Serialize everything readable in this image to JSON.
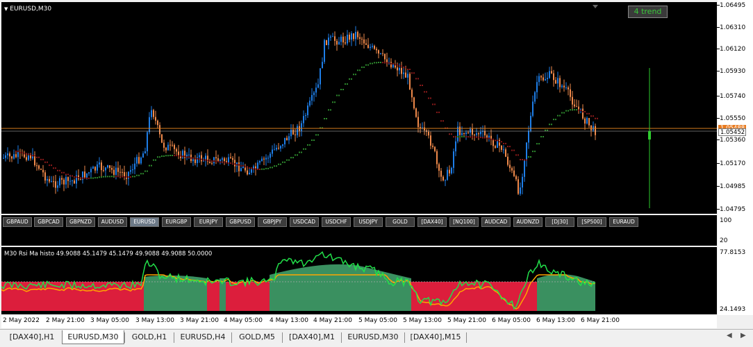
{
  "main_chart": {
    "title": "EURUSD,M30",
    "trend_button": "4 trend",
    "current_price_box": "1.05488",
    "current_price_box2": "1.05452",
    "price_axis": [
      "1.06495",
      "1.06310",
      "1.06120",
      "1.05930",
      "1.05740",
      "1.05550",
      "1.05360",
      "1.05170",
      "1.04985",
      "1.04795"
    ]
  },
  "symbol_panel": {
    "axis": [
      "100",
      "20"
    ],
    "buttons": [
      "GBPAUD",
      "GBPCAD",
      "GBPNZD",
      "AUDUSD",
      "EURUSD",
      "EURGBP",
      "EURJPY",
      "GBPUSD",
      "GBPJPY",
      "USDCAD",
      "USDCHF",
      "USDJPY",
      "GOLD",
      "[DAX40]",
      "[NQ100]",
      "AUDCAD",
      "AUDNZD",
      "[DJ30]",
      "[SP500]",
      "EURAUD"
    ],
    "active": "EURUSD"
  },
  "indicator": {
    "title": "M30 Rsi Ma histo 49.9088 45.1479 45.1479 49.9088 49.9088 50.0000",
    "axis_top": "77.8153",
    "axis_bottom": "24.1493"
  },
  "time_axis": [
    "2 May 2022",
    "2 May 21:00",
    "3 May 05:00",
    "3 May 13:00",
    "3 May 21:00",
    "4 May 05:00",
    "4 May 13:00",
    "4 May 21:00",
    "5 May 05:00",
    "5 May 13:00",
    "5 May 21:00",
    "6 May 05:00",
    "6 May 13:00",
    "6 May 21:00"
  ],
  "tabs": [
    "[DAX40],H1",
    "EURUSD,M30",
    "GOLD,H1",
    "EURUSD,H4",
    "GOLD,M5",
    "[DAX40],M1",
    "EURUSD,M30",
    "[DAX40],M15"
  ],
  "active_tab": "EURUSD,M30",
  "icons": {
    "tab_left": "chevron-left-icon",
    "tab_right": "chevron-right-icon",
    "title_arrow": "triangle-down-icon"
  },
  "colors": {
    "bull_candle": "#1e7ee8",
    "bear_candle": "#f08a4b",
    "price_line": "#d97c1c",
    "rsi_line": "#22e04a",
    "ma_line": "#ffa500",
    "histo_red": "#dc1e3c",
    "histo_green": "#3a9060"
  }
}
